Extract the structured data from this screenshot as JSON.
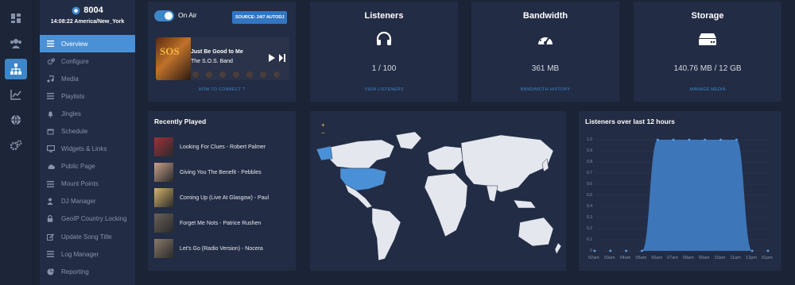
{
  "station": {
    "id": "8004",
    "time": "14:08:22 America/New_York"
  },
  "rail": [
    "dashboard-icon",
    "users-icon",
    "sitemap-icon",
    "chart-icon",
    "globe-icon",
    "cogs-icon"
  ],
  "nav": [
    {
      "label": "Overview",
      "icon": "list-icon",
      "active": true
    },
    {
      "label": "Configure",
      "icon": "cogs-icon"
    },
    {
      "label": "Media",
      "icon": "music-icon"
    },
    {
      "label": "Playlists",
      "icon": "list-icon"
    },
    {
      "label": "Jingles",
      "icon": "bell-icon"
    },
    {
      "label": "Schedule",
      "icon": "calendar-icon"
    },
    {
      "label": "Widgets & Links",
      "icon": "monitor-icon"
    },
    {
      "label": "Public Page",
      "icon": "cloud-icon"
    },
    {
      "label": "Mount Points",
      "icon": "list-icon"
    },
    {
      "label": "DJ Manager",
      "icon": "user-icon"
    },
    {
      "label": "GeoIP Country Locking",
      "icon": "lock-icon"
    },
    {
      "label": "Update Song Title",
      "icon": "edit-icon"
    },
    {
      "label": "Log Manager",
      "icon": "list-icon"
    },
    {
      "label": "Reporting",
      "icon": "pie-icon"
    }
  ],
  "onair": {
    "label": "On Air",
    "source": "SOURCE: 24/7 AUTODJ",
    "song_title": "Just Be Good to Me",
    "artist": "The S.O.S. Band",
    "art_text": "SOS",
    "how_to_connect": "HOW TO CONNECT ?"
  },
  "listeners": {
    "title": "Listeners",
    "value": "1 / 100",
    "link": "VIEW LISTENERS",
    "icon": "headphones-icon"
  },
  "bandwidth": {
    "title": "Bandwidth",
    "value": "361 MB",
    "link": "BANDWIDTH HISTORY",
    "icon": "gauge-icon"
  },
  "storage": {
    "title": "Storage",
    "value": "140.76 MB / 12 GB",
    "link": "MANAGE MEDIA",
    "icon": "hdd-icon"
  },
  "recently_played": {
    "title": "Recently Played",
    "items": [
      {
        "label": "Looking For Clues - Robert Palmer",
        "color": "#a0303a"
      },
      {
        "label": "Giving You The Benefit - Pebbles",
        "color": "#c7a08a"
      },
      {
        "label": "Coming Up (Live At Glasgow) - Paul",
        "color": "#d6b36a"
      },
      {
        "label": "Forget Me Nots - Patrice Rushen",
        "color": "#6a6058"
      },
      {
        "label": "Let's Go (Radio Version) - Nocera",
        "color": "#8a7a6a"
      }
    ]
  },
  "map": {
    "zoom_in": "+",
    "zoom_out": "−",
    "highlight": [
      "United States",
      "Greenland"
    ]
  },
  "chart_data": {
    "type": "area",
    "title": "Listeners over last 12 hours",
    "categories": [
      "02am",
      "03am",
      "04am",
      "05am",
      "06am",
      "07am",
      "08am",
      "09am",
      "10am",
      "11am",
      "12pm",
      "01pm"
    ],
    "values": [
      0,
      0,
      0,
      0,
      1,
      1,
      1,
      1,
      1,
      1,
      0,
      0
    ],
    "yticks": [
      "0",
      "0.1",
      "0.2",
      "0.3",
      "0.4",
      "0.5",
      "0.6",
      "0.7",
      "0.8",
      "0.9",
      "1.0"
    ],
    "ylim": [
      0,
      1.0
    ],
    "color": "#3d76b9"
  }
}
